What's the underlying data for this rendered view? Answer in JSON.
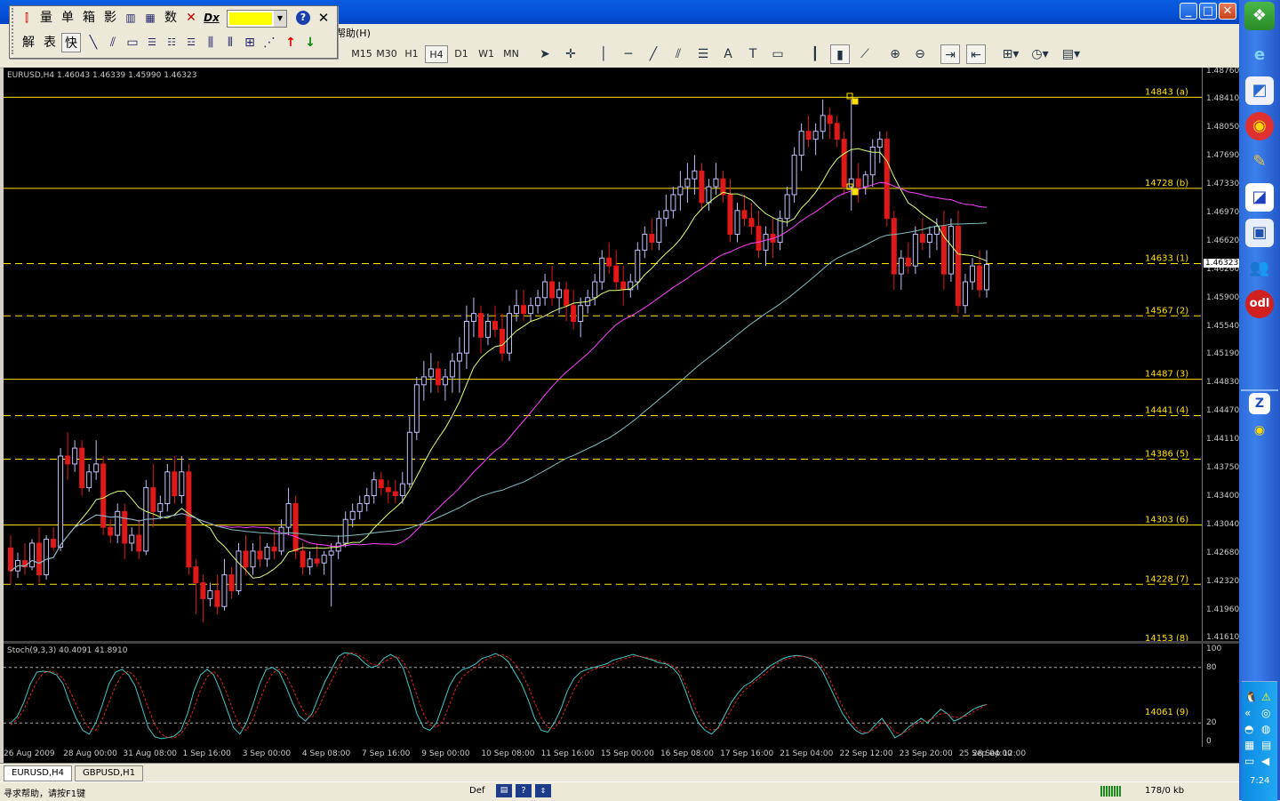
{
  "menu": {
    "help_label": "帮助(H)"
  },
  "floating_toolbar": {
    "row1": [
      "量",
      "单",
      "箱",
      "影",
      "数"
    ],
    "row2": [
      "解",
      "表",
      "快"
    ],
    "color_swatch": "#ffff00"
  },
  "timeframes": [
    "M15",
    "M30",
    "H1",
    "H4",
    "D1",
    "W1",
    "MN"
  ],
  "active_timeframe": "H4",
  "partial_label": "5",
  "chart": {
    "header": "EURUSD,H4  1.46043 1.46339 1.45990 1.46323",
    "bid_label": "1.46323",
    "price_ticks": [
      "1.48760",
      "1.48410",
      "1.48050",
      "1.47690",
      "1.47330",
      "1.46970",
      "1.46620",
      "1.46260",
      "1.45900",
      "1.45540",
      "1.45190",
      "1.44830",
      "1.44470",
      "1.44110",
      "1.43750",
      "1.43400",
      "1.43040",
      "1.42680",
      "1.42320",
      "1.41960",
      "1.41610"
    ],
    "levels": [
      {
        "label": "14843 (a)",
        "price": 1.4843,
        "style": "solid"
      },
      {
        "label": "14728 (b)",
        "price": 1.4728,
        "style": "solid"
      },
      {
        "label": "14633 (1)",
        "price": 1.4633,
        "style": "dash"
      },
      {
        "label": "14567 (2)",
        "price": 1.4567,
        "style": "dash"
      },
      {
        "label": "14487 (3)",
        "price": 1.4487,
        "style": "solid"
      },
      {
        "label": "14441 (4)",
        "price": 1.4441,
        "style": "dash"
      },
      {
        "label": "14386 (5)",
        "price": 1.4386,
        "style": "dash"
      },
      {
        "label": "14303 (6)",
        "price": 1.4303,
        "style": "solid"
      },
      {
        "label": "14228 (7)",
        "price": 1.4228,
        "style": "dash"
      },
      {
        "label": "14153 (8)",
        "price": 1.4153,
        "style": "dash"
      }
    ],
    "colors": {
      "bull": "#c0c0ff",
      "bear": "#e01818",
      "ma_fast": "#d8ff70",
      "ma_mid": "#ff40ff",
      "ma_slow": "#80c0c0",
      "level": "#ffe000"
    }
  },
  "stoch": {
    "header": "Stoch(9,3,3) 40.4091 41.8910",
    "ticks": [
      "100",
      "80",
      "20",
      "0"
    ],
    "level_label": "14061 (9)",
    "k_values": [
      20,
      27,
      42,
      62,
      75,
      76,
      75,
      72,
      62,
      42,
      25,
      12,
      8,
      20,
      40,
      62,
      75,
      78,
      72,
      60,
      38,
      15,
      5,
      3,
      4,
      6,
      12,
      30,
      55,
      72,
      78,
      72,
      55,
      35,
      15,
      8,
      20,
      40,
      62,
      78,
      80,
      75,
      60,
      42,
      28,
      22,
      30,
      48,
      65,
      78,
      92,
      96,
      95,
      92,
      85,
      80,
      82,
      90,
      94,
      90,
      78,
      55,
      30,
      15,
      12,
      20,
      40,
      60,
      72,
      78,
      80,
      84,
      90,
      92,
      95,
      92,
      86,
      74,
      62,
      45,
      25,
      12,
      10,
      20,
      35,
      55,
      68,
      75,
      78,
      80,
      82,
      84,
      88,
      90,
      92,
      94,
      92,
      90,
      88,
      85,
      84,
      80,
      72,
      55,
      35,
      20,
      12,
      8,
      15,
      28,
      42,
      52,
      60,
      64,
      70,
      76,
      82,
      86,
      90,
      92,
      93,
      92,
      90,
      85,
      75,
      60,
      45,
      30,
      20,
      12,
      8,
      10,
      18,
      25,
      15,
      4,
      8,
      15,
      20,
      25,
      20,
      28,
      35,
      30,
      22,
      25,
      30,
      35,
      38,
      40
    ],
    "d_values": [
      18,
      24,
      34,
      50,
      65,
      74,
      76,
      74,
      68,
      55,
      40,
      25,
      14,
      12,
      24,
      42,
      60,
      72,
      76,
      70,
      56,
      36,
      18,
      8,
      4,
      4,
      8,
      18,
      36,
      56,
      70,
      76,
      68,
      52,
      32,
      16,
      12,
      24,
      44,
      62,
      74,
      78,
      72,
      58,
      42,
      30,
      26,
      36,
      52,
      66,
      80,
      92,
      96,
      94,
      90,
      84,
      82,
      86,
      90,
      92,
      86,
      72,
      50,
      30,
      18,
      15,
      22,
      40,
      58,
      70,
      76,
      80,
      86,
      90,
      92,
      94,
      91,
      84,
      74,
      60,
      42,
      26,
      15,
      14,
      24,
      40,
      56,
      68,
      74,
      78,
      80,
      82,
      84,
      88,
      90,
      92,
      92,
      91,
      89,
      87,
      85,
      82,
      76,
      62,
      45,
      28,
      16,
      12,
      14,
      22,
      34,
      46,
      55,
      61,
      67,
      72,
      78,
      84,
      88,
      90,
      92,
      92,
      91,
      88,
      80,
      68,
      52,
      38,
      26,
      16,
      10,
      10,
      14,
      20,
      18,
      10,
      8,
      12,
      18,
      22,
      22,
      26,
      30,
      30,
      26,
      26,
      28,
      32,
      36,
      40
    ]
  },
  "time_ticks": [
    "26 Aug 2009",
    "28 Aug 00:00",
    "31 Aug 08:00",
    "1 Sep 16:00",
    "3 Sep 00:00",
    "4 Sep 08:00",
    "7 Sep 16:00",
    "9 Sep 00:00",
    "10 Sep 08:00",
    "11 Sep 16:00",
    "15 Sep 00:00",
    "16 Sep 08:00",
    "17 Sep 16:00",
    "21 Sep 04:00",
    "22 Sep 12:00",
    "23 Sep 20:00",
    "25 Sep 04:00",
    "28 Sep 12:00"
  ],
  "tabs": [
    {
      "label": "EURUSD,H4",
      "active": true
    },
    {
      "label": "GBPUSD,H1",
      "active": false
    }
  ],
  "status": {
    "help_text": "寻求帮助，请按F1键",
    "profile": "Def",
    "traffic": "178/0 kb"
  },
  "clock": "7:24",
  "ohlc": [
    [
      1.4274,
      1.429,
      1.4228,
      1.4245
    ],
    [
      1.4245,
      1.4268,
      1.4236,
      1.4258
    ],
    [
      1.4258,
      1.428,
      1.424,
      1.425
    ],
    [
      1.425,
      1.4285,
      1.4246,
      1.428
    ],
    [
      1.428,
      1.43,
      1.423,
      1.424
    ],
    [
      1.424,
      1.429,
      1.4234,
      1.4285
    ],
    [
      1.4285,
      1.43,
      1.427,
      1.4275
    ],
    [
      1.4275,
      1.44,
      1.427,
      1.439
    ],
    [
      1.439,
      1.442,
      1.436,
      1.438
    ],
    [
      1.438,
      1.441,
      1.437,
      1.44
    ],
    [
      1.44,
      1.441,
      1.434,
      1.435
    ],
    [
      1.435,
      1.438,
      1.4345,
      1.437
    ],
    [
      1.437,
      1.441,
      1.436,
      1.438
    ],
    [
      1.438,
      1.439,
      1.429,
      1.43
    ],
    [
      1.43,
      1.431,
      1.428,
      1.429
    ],
    [
      1.429,
      1.433,
      1.428,
      1.432
    ],
    [
      1.432,
      1.433,
      1.426,
      1.428
    ],
    [
      1.428,
      1.43,
      1.427,
      1.429
    ],
    [
      1.429,
      1.431,
      1.426,
      1.427
    ],
    [
      1.427,
      1.436,
      1.4265,
      1.435
    ],
    [
      1.435,
      1.438,
      1.43,
      1.432
    ],
    [
      1.432,
      1.434,
      1.431,
      1.433
    ],
    [
      1.433,
      1.438,
      1.432,
      1.437
    ],
    [
      1.437,
      1.439,
      1.433,
      1.434
    ],
    [
      1.434,
      1.439,
      1.433,
      1.437
    ],
    [
      1.437,
      1.438,
      1.424,
      1.425
    ],
    [
      1.425,
      1.426,
      1.419,
      1.423
    ],
    [
      1.423,
      1.424,
      1.418,
      1.421
    ],
    [
      1.421,
      1.423,
      1.42,
      1.422
    ],
    [
      1.422,
      1.424,
      1.419,
      1.42
    ],
    [
      1.42,
      1.426,
      1.4195,
      1.424
    ],
    [
      1.424,
      1.425,
      1.421,
      1.422
    ],
    [
      1.422,
      1.428,
      1.4215,
      1.427
    ],
    [
      1.427,
      1.429,
      1.424,
      1.425
    ],
    [
      1.425,
      1.428,
      1.424,
      1.427
    ],
    [
      1.427,
      1.429,
      1.425,
      1.426
    ],
    [
      1.426,
      1.428,
      1.425,
      1.4275
    ],
    [
      1.4275,
      1.43,
      1.426,
      1.427
    ],
    [
      1.427,
      1.431,
      1.4265,
      1.43
    ],
    [
      1.43,
      1.435,
      1.429,
      1.433
    ],
    [
      1.433,
      1.434,
      1.426,
      1.427
    ],
    [
      1.427,
      1.428,
      1.424,
      1.425
    ],
    [
      1.425,
      1.427,
      1.424,
      1.426
    ],
    [
      1.426,
      1.428,
      1.425,
      1.4255
    ],
    [
      1.4255,
      1.427,
      1.424,
      1.4265
    ],
    [
      1.4265,
      1.428,
      1.42,
      1.427
    ],
    [
      1.427,
      1.429,
      1.426,
      1.428
    ],
    [
      1.428,
      1.432,
      1.4275,
      1.431
    ],
    [
      1.431,
      1.433,
      1.43,
      1.432
    ],
    [
      1.432,
      1.434,
      1.431,
      1.433
    ],
    [
      1.433,
      1.435,
      1.432,
      1.434
    ],
    [
      1.434,
      1.437,
      1.433,
      1.436
    ],
    [
      1.436,
      1.437,
      1.434,
      1.435
    ],
    [
      1.435,
      1.436,
      1.433,
      1.4345
    ],
    [
      1.4345,
      1.436,
      1.433,
      1.434
    ],
    [
      1.434,
      1.437,
      1.433,
      1.4355
    ],
    [
      1.4355,
      1.444,
      1.435,
      1.442
    ],
    [
      1.442,
      1.449,
      1.441,
      1.448
    ],
    [
      1.448,
      1.451,
      1.446,
      1.449
    ],
    [
      1.449,
      1.452,
      1.447,
      1.45
    ],
    [
      1.45,
      1.451,
      1.447,
      1.448
    ],
    [
      1.448,
      1.45,
      1.446,
      1.449
    ],
    [
      1.449,
      1.452,
      1.447,
      1.451
    ],
    [
      1.451,
      1.454,
      1.447,
      1.452
    ],
    [
      1.452,
      1.458,
      1.45,
      1.456
    ],
    [
      1.456,
      1.459,
      1.454,
      1.457
    ],
    [
      1.457,
      1.458,
      1.452,
      1.454
    ],
    [
      1.454,
      1.457,
      1.453,
      1.456
    ],
    [
      1.456,
      1.458,
      1.454,
      1.455
    ],
    [
      1.455,
      1.457,
      1.451,
      1.452
    ],
    [
      1.452,
      1.458,
      1.451,
      1.457
    ],
    [
      1.457,
      1.46,
      1.456,
      1.458
    ],
    [
      1.458,
      1.46,
      1.456,
      1.457
    ],
    [
      1.457,
      1.459,
      1.456,
      1.458
    ],
    [
      1.458,
      1.46,
      1.457,
      1.459
    ],
    [
      1.459,
      1.462,
      1.458,
      1.461
    ],
    [
      1.461,
      1.463,
      1.458,
      1.459
    ],
    [
      1.459,
      1.461,
      1.457,
      1.46
    ],
    [
      1.46,
      1.461,
      1.456,
      1.458
    ],
    [
      1.458,
      1.46,
      1.455,
      1.456
    ],
    [
      1.456,
      1.459,
      1.454,
      1.458
    ],
    [
      1.458,
      1.46,
      1.457,
      1.459
    ],
    [
      1.459,
      1.462,
      1.458,
      1.461
    ],
    [
      1.461,
      1.465,
      1.46,
      1.464
    ],
    [
      1.464,
      1.466,
      1.462,
      1.463
    ],
    [
      1.463,
      1.465,
      1.46,
      1.461
    ],
    [
      1.461,
      1.463,
      1.458,
      1.46
    ],
    [
      1.46,
      1.462,
      1.459,
      1.461
    ],
    [
      1.461,
      1.466,
      1.46,
      1.465
    ],
    [
      1.465,
      1.468,
      1.464,
      1.467
    ],
    [
      1.467,
      1.469,
      1.465,
      1.466
    ],
    [
      1.466,
      1.47,
      1.465,
      1.469
    ],
    [
      1.469,
      1.472,
      1.468,
      1.47
    ],
    [
      1.47,
      1.473,
      1.469,
      1.472
    ],
    [
      1.472,
      1.475,
      1.47,
      1.473
    ],
    [
      1.473,
      1.476,
      1.471,
      1.474
    ],
    [
      1.474,
      1.477,
      1.472,
      1.475
    ],
    [
      1.475,
      1.476,
      1.47,
      1.471
    ],
    [
      1.471,
      1.474,
      1.47,
      1.473
    ],
    [
      1.473,
      1.476,
      1.472,
      1.474
    ],
    [
      1.474,
      1.475,
      1.471,
      1.472
    ],
    [
      1.472,
      1.474,
      1.466,
      1.467
    ],
    [
      1.467,
      1.471,
      1.466,
      1.47
    ],
    [
      1.47,
      1.472,
      1.468,
      1.469
    ],
    [
      1.469,
      1.471,
      1.467,
      1.468
    ],
    [
      1.468,
      1.47,
      1.464,
      1.465
    ],
    [
      1.465,
      1.468,
      1.463,
      1.467
    ],
    [
      1.467,
      1.469,
      1.464,
      1.466
    ],
    [
      1.466,
      1.47,
      1.465,
      1.469
    ],
    [
      1.469,
      1.473,
      1.468,
      1.472
    ],
    [
      1.472,
      1.478,
      1.471,
      1.477
    ],
    [
      1.477,
      1.481,
      1.475,
      1.48
    ],
    [
      1.48,
      1.482,
      1.478,
      1.479
    ],
    [
      1.479,
      1.481,
      1.477,
      1.48
    ],
    [
      1.48,
      1.484,
      1.479,
      1.482
    ],
    [
      1.482,
      1.483,
      1.479,
      1.481
    ],
    [
      1.481,
      1.482,
      1.478,
      1.479
    ],
    [
      1.479,
      1.48,
      1.472,
      1.473
    ],
    [
      1.473,
      1.484,
      1.47,
      1.474
    ],
    [
      1.474,
      1.476,
      1.471,
      1.473
    ],
    [
      1.473,
      1.475,
      1.472,
      1.4745
    ],
    [
      1.4745,
      1.479,
      1.473,
      1.478
    ],
    [
      1.478,
      1.48,
      1.476,
      1.479
    ],
    [
      1.479,
      1.48,
      1.468,
      1.469
    ],
    [
      1.469,
      1.47,
      1.46,
      1.462
    ],
    [
      1.462,
      1.465,
      1.46,
      1.464
    ],
    [
      1.464,
      1.466,
      1.462,
      1.463
    ],
    [
      1.463,
      1.468,
      1.462,
      1.467
    ],
    [
      1.467,
      1.469,
      1.465,
      1.466
    ],
    [
      1.466,
      1.468,
      1.464,
      1.467
    ],
    [
      1.467,
      1.469,
      1.465,
      1.468
    ],
    [
      1.468,
      1.47,
      1.46,
      1.462
    ],
    [
      1.462,
      1.469,
      1.461,
      1.468
    ],
    [
      1.468,
      1.47,
      1.457,
      1.458
    ],
    [
      1.458,
      1.462,
      1.457,
      1.461
    ],
    [
      1.461,
      1.464,
      1.46,
      1.463
    ],
    [
      1.463,
      1.465,
      1.459,
      1.46
    ],
    [
      1.46,
      1.465,
      1.459,
      1.4632
    ]
  ]
}
